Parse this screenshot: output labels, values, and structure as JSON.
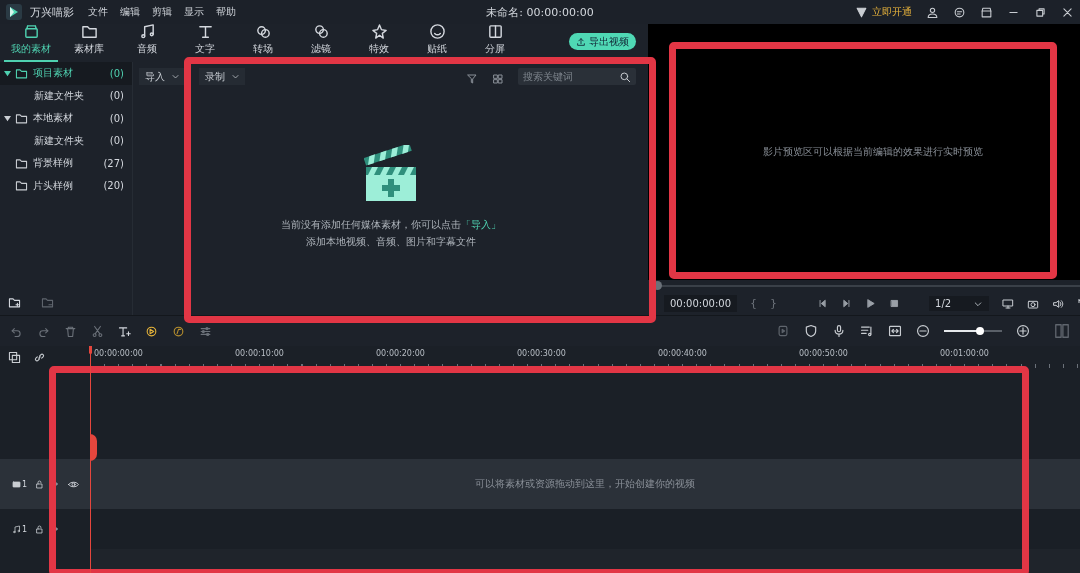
{
  "window": {
    "app_name": "万兴喵影",
    "menu": [
      "文件",
      "编辑",
      "剪辑",
      "显示",
      "帮助"
    ],
    "title": "未命名: 00:00:00:00",
    "vip_label": "立即开通"
  },
  "toolbar": {
    "tabs": [
      {
        "label": "我的素材",
        "selected": true
      },
      {
        "label": "素材库",
        "selected": false
      },
      {
        "label": "音频",
        "selected": false
      },
      {
        "label": "文字",
        "selected": false
      },
      {
        "label": "转场",
        "selected": false
      },
      {
        "label": "滤镜",
        "selected": false
      },
      {
        "label": "特效",
        "selected": false
      },
      {
        "label": "贴纸",
        "selected": false
      },
      {
        "label": "分屏",
        "selected": false
      }
    ],
    "export_button": "导出视频"
  },
  "sidebar": {
    "items": [
      {
        "label": "项目素材",
        "count": "(0)",
        "selected": true,
        "expanded": true,
        "children": [
          {
            "label": "新建文件夹",
            "count": "(0)",
            "selected": false
          }
        ]
      },
      {
        "label": "本地素材",
        "count": "(0)",
        "selected": false,
        "expanded": true,
        "children": [
          {
            "label": "新建文件夹",
            "count": "(0)",
            "selected": false
          }
        ]
      },
      {
        "label": "背景样例",
        "count": "(27)",
        "selected": false
      },
      {
        "label": "片头样例",
        "count": "(20)",
        "selected": false
      }
    ]
  },
  "media": {
    "dropdowns": [
      "导入",
      "录制"
    ],
    "search": {
      "placeholder": "搜索关键词"
    },
    "empty_message": {
      "text": "当前没有添加任何媒体素材，你可以点击",
      "link": "「导入」",
      "line2": "添加本地视频、音频、图片和字幕文件"
    }
  },
  "preview": {
    "message": "影片预览区可以根据当前编辑的效果进行实时预览",
    "progress": {
      "level": 0
    },
    "timecode": "00:00:00:00",
    "mark_in": "{",
    "mark_out": "}",
    "quality": "1/2"
  },
  "timeline": {
    "zoom": {
      "level": 0.62
    },
    "ruler": [
      "00:00:00:00",
      "00:00:10:00",
      "00:00:20:00",
      "00:00:30:00",
      "00:00:40:00",
      "00:00:50:00",
      "00:01:00:00"
    ],
    "drop_hint": "可以将素材或资源拖动到这里，开始创建你的视频",
    "tracks": [
      {
        "kind": "video",
        "number": "1"
      },
      {
        "kind": "audio",
        "number": "1"
      }
    ]
  },
  "annotations": [
    {
      "kind": "frame"
    },
    {
      "kind": "frame"
    },
    {
      "kind": "frame"
    }
  ]
}
